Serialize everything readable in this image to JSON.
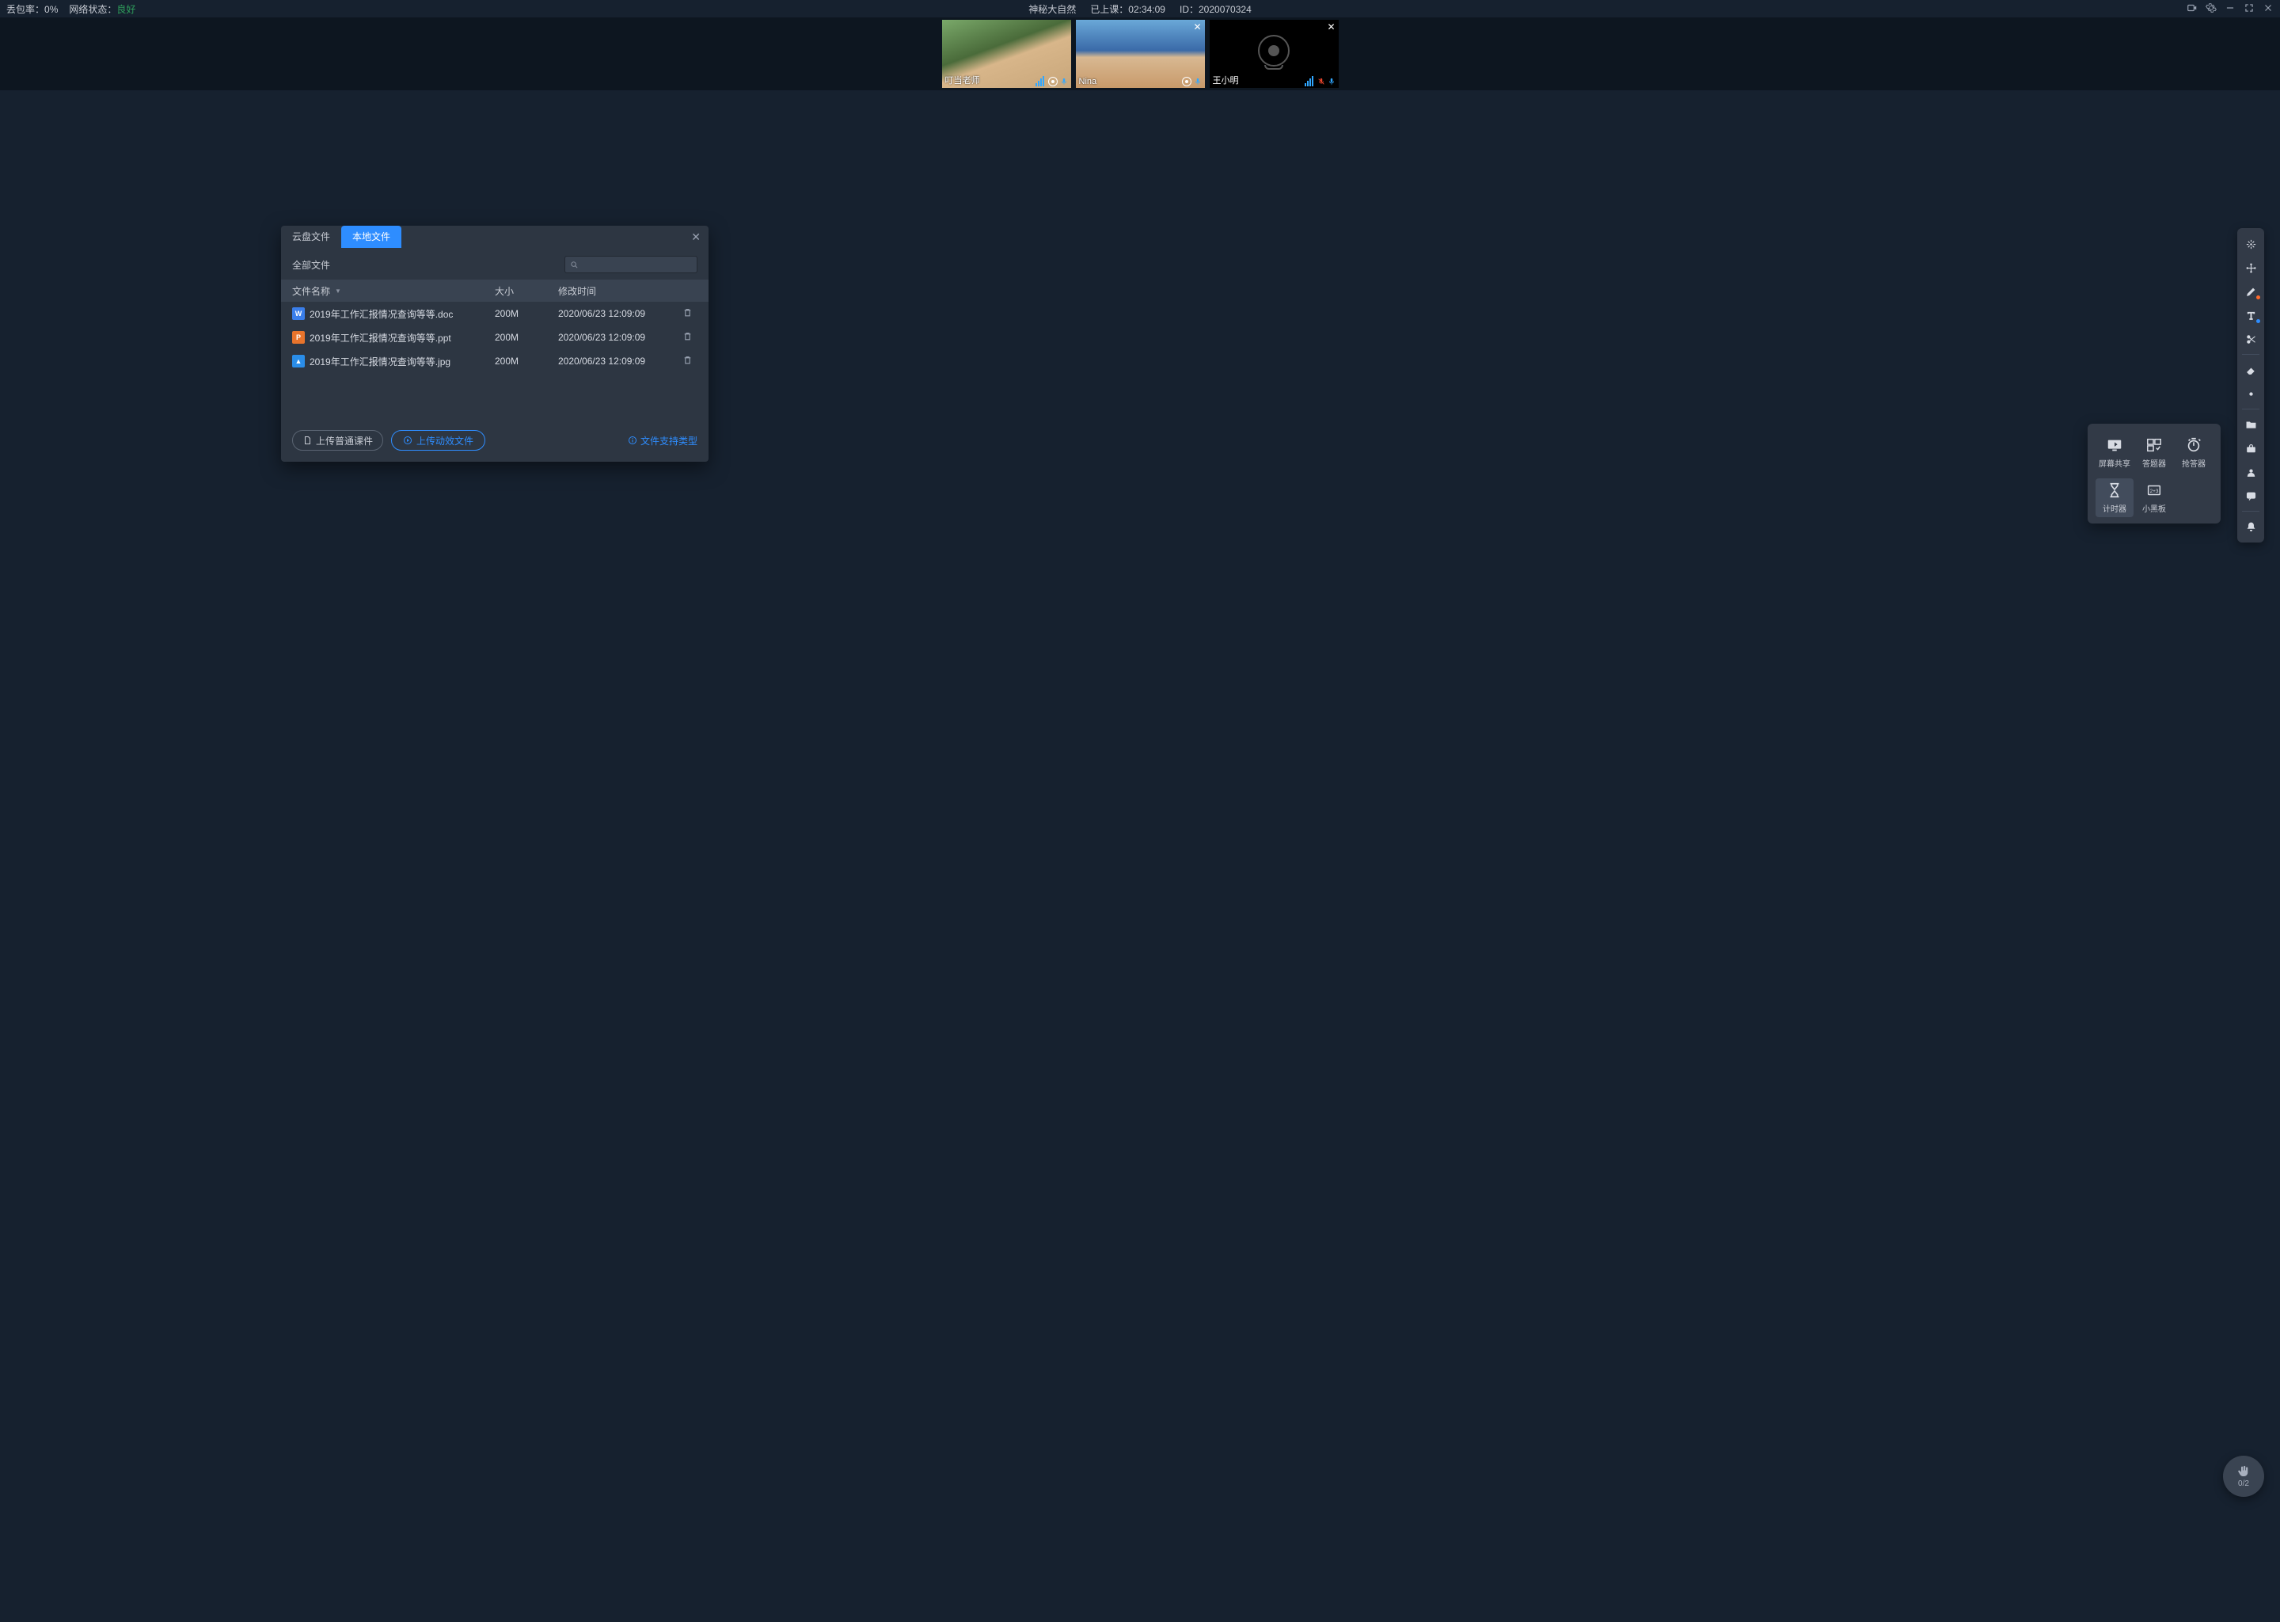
{
  "topbar": {
    "loss_label": "丢包率：",
    "loss_value": "0%",
    "net_label": "网络状态：",
    "net_value": "良好",
    "title": "神秘大自然",
    "elapsed_label": "已上课：",
    "elapsed_value": "02:34:09",
    "id_label": "ID：",
    "id_value": "2020070324"
  },
  "tiles": {
    "t1": {
      "name": "叮当老师"
    },
    "t2": {
      "name": "Nina"
    },
    "t3": {
      "name": "王小明"
    }
  },
  "dialog": {
    "tab_cloud": "云盘文件",
    "tab_local": "本地文件",
    "all_files": "全部文件",
    "cols": {
      "name": "文件名称",
      "size": "大小",
      "time": "修改时间"
    },
    "rows": {
      "r1": {
        "name": "2019年工作汇报情况查询等等.doc",
        "size": "200M",
        "time": "2020/06/23 12:09:09"
      },
      "r2": {
        "name": "2019年工作汇报情况查询等等.ppt",
        "size": "200M",
        "time": "2020/06/23 12:09:09"
      },
      "r3": {
        "name": "2019年工作汇报情况查询等等.jpg",
        "size": "200M",
        "time": "2020/06/23 12:09:09"
      }
    },
    "btn_upload_normal": "上传普通课件",
    "btn_upload_anim": "上传动效文件",
    "support_link": "文件支持类型"
  },
  "tools": {
    "screen_share": "屏幕共享",
    "answer_box": "答题器",
    "responder": "抢答器",
    "timer": "计时器",
    "small_board": "小黑板"
  },
  "hand": {
    "count": "0/2"
  }
}
